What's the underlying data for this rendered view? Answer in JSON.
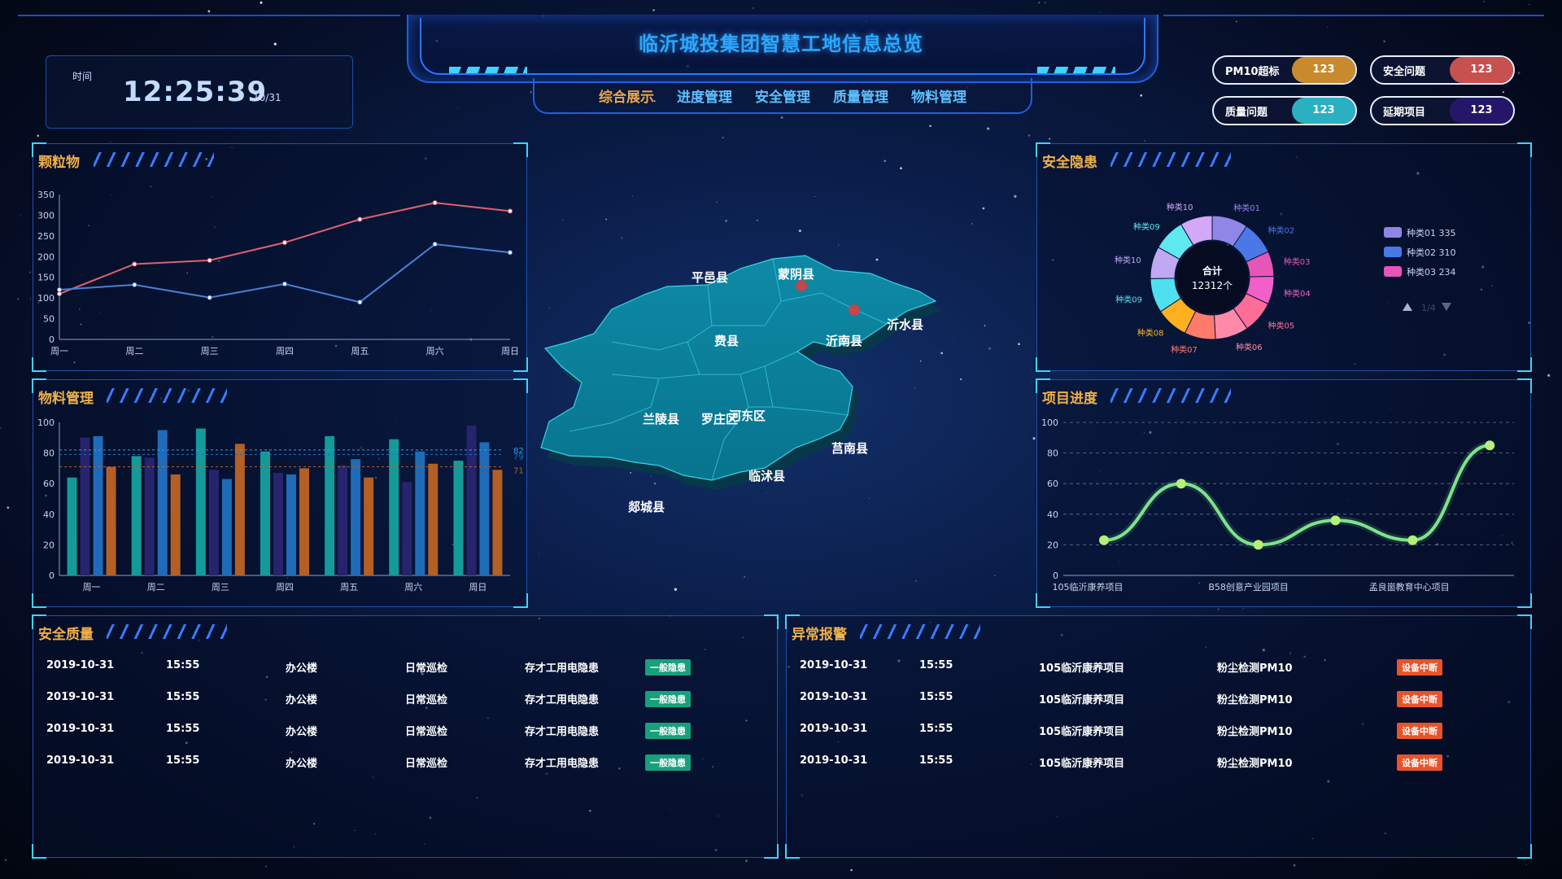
{
  "header": {
    "title": "临沂城投集团智慧工地信息总览",
    "nav": [
      {
        "label": "综合展示",
        "active": true
      },
      {
        "label": "进度管理",
        "active": false
      },
      {
        "label": "安全管理",
        "active": false
      },
      {
        "label": "质量管理",
        "active": false
      },
      {
        "label": "物料管理",
        "active": false
      }
    ]
  },
  "clock": {
    "label": "时间",
    "time": "12:25:39",
    "date": "10/31"
  },
  "badges": [
    {
      "label": "PM10超标",
      "value": "123",
      "color": "#c98a2e"
    },
    {
      "label": "安全问题",
      "value": "123",
      "color": "#c7514e"
    },
    {
      "label": "质量问题",
      "value": "123",
      "color": "#2bb0c2"
    },
    {
      "label": "延期项目",
      "value": "123",
      "color": "#24176a"
    }
  ],
  "panels": {
    "particles": "颗粒物",
    "materials": "物料管理",
    "safety": "安全隐患",
    "progress": "项目进度",
    "safety_quality": "安全质量",
    "alarms": "异常报警"
  },
  "chart_data": [
    {
      "id": "particles",
      "type": "line",
      "categories": [
        "周一",
        "周二",
        "周三",
        "周四",
        "周五",
        "周六",
        "周日"
      ],
      "ylim": [
        0,
        350
      ],
      "yticks": [
        "0",
        "50",
        "100",
        "150",
        "200",
        "250",
        "300",
        "350"
      ],
      "series": [
        {
          "values": [
            110,
            182,
            191,
            234,
            290,
            330,
            310
          ],
          "color": "#e0606e"
        },
        {
          "values": [
            120,
            132,
            101,
            134,
            90,
            230,
            210
          ],
          "color": "#4a7fd6"
        }
      ]
    },
    {
      "id": "materials",
      "type": "bar",
      "categories": [
        "周一",
        "周二",
        "周三",
        "周四",
        "周五",
        "周六",
        "周日"
      ],
      "ylim": [
        0,
        100
      ],
      "yticks": [
        "0",
        "20",
        "40",
        "60",
        "80",
        "100"
      ],
      "series": [
        {
          "values": [
            64,
            78,
            96,
            81,
            91,
            89,
            75
          ],
          "color": "#159a9a"
        },
        {
          "values": [
            90,
            77,
            69,
            67,
            72,
            61,
            98
          ],
          "color": "#27246e"
        },
        {
          "values": [
            91,
            95,
            63,
            66,
            76,
            81,
            87
          ],
          "color": "#1f6bb8"
        },
        {
          "values": [
            71,
            66,
            86,
            70,
            64,
            73,
            69
          ],
          "color": "#b35f25"
        }
      ],
      "markers": [
        {
          "label": "82",
          "value": 82,
          "color": "#2da6e0"
        },
        {
          "label": "79",
          "value": 79,
          "color": "#1d6fbf"
        },
        {
          "label": "71",
          "value": 71,
          "color": "#b35f25"
        }
      ]
    },
    {
      "id": "safety",
      "type": "pie",
      "center_label": "合计",
      "center_value": "12312个",
      "slices": [
        {
          "name": "种类01",
          "value": 335,
          "color": "#8f86e8"
        },
        {
          "name": "种类02",
          "value": 310,
          "color": "#4a78e6"
        },
        {
          "name": "种类03",
          "value": 234,
          "color": "#e655b8"
        },
        {
          "name": "种类04",
          "value": 260,
          "color": "#f25fc8"
        },
        {
          "name": "种类05",
          "value": 300,
          "color": "#ff6c98"
        },
        {
          "name": "种类06",
          "value": 310,
          "color": "#ff8aa8"
        },
        {
          "name": "种类07",
          "value": 290,
          "color": "#ff7a6a"
        },
        {
          "name": "种类08",
          "value": 300,
          "color": "#ffb020"
        },
        {
          "name": "种类09",
          "value": 320,
          "color": "#4fe0ef"
        },
        {
          "name": "种类10",
          "value": 300,
          "color": "#c1a8f2"
        },
        {
          "name": "种类09",
          "value": 300,
          "color": "#5fe8f0"
        },
        {
          "name": "种类10",
          "value": 300,
          "color": "#d4a8f6"
        }
      ],
      "legend": [
        {
          "name": "种类01",
          "value": "335",
          "color": "#8f86e8"
        },
        {
          "name": "种类02",
          "value": "310",
          "color": "#4a78e6"
        },
        {
          "name": "种类03",
          "value": "234",
          "color": "#e655b8"
        }
      ],
      "pager": "1/4"
    },
    {
      "id": "progress",
      "type": "line",
      "categories": [
        "105临沂康养项目",
        "",
        "B58创意产业园项目",
        "",
        "孟良崮教育中心项目",
        ""
      ],
      "ylim": [
        0,
        100
      ],
      "yticks": [
        "0",
        "20",
        "40",
        "60",
        "80",
        "100"
      ],
      "series": [
        {
          "values": [
            23,
            60,
            20,
            36,
            23,
            85
          ],
          "color": "#7fe38a"
        }
      ]
    }
  ],
  "map": {
    "counties": [
      "平邑县",
      "蒙阴县",
      "沂水县",
      "费县",
      "沂南县",
      "兰陵县",
      "罗庄区",
      "河东区",
      "莒南县",
      "临沭县",
      "郯城县"
    ]
  },
  "safety_quality": {
    "rows": [
      {
        "date": "2019-10-31",
        "time": "15:55",
        "place": "办公楼",
        "type": "日常巡检",
        "issue": "存才工用电隐患",
        "tag": "一般隐患"
      },
      {
        "date": "2019-10-31",
        "time": "15:55",
        "place": "办公楼",
        "type": "日常巡检",
        "issue": "存才工用电隐患",
        "tag": "一般隐患"
      },
      {
        "date": "2019-10-31",
        "time": "15:55",
        "place": "办公楼",
        "type": "日常巡检",
        "issue": "存才工用电隐患",
        "tag": "一般隐患"
      },
      {
        "date": "2019-10-31",
        "time": "15:55",
        "place": "办公楼",
        "type": "日常巡检",
        "issue": "存才工用电隐患",
        "tag": "一般隐患"
      }
    ]
  },
  "alarms": {
    "rows": [
      {
        "date": "2019-10-31",
        "time": "15:55",
        "project": "105临沂康养项目",
        "sensor": "粉尘检测PM10",
        "tag": "设备中断"
      },
      {
        "date": "2019-10-31",
        "time": "15:55",
        "project": "105临沂康养项目",
        "sensor": "粉尘检测PM10",
        "tag": "设备中断"
      },
      {
        "date": "2019-10-31",
        "time": "15:55",
        "project": "105临沂康养项目",
        "sensor": "粉尘检测PM10",
        "tag": "设备中断"
      },
      {
        "date": "2019-10-31",
        "time": "15:55",
        "project": "105临沂康养项目",
        "sensor": "粉尘检测PM10",
        "tag": "设备中断"
      }
    ]
  }
}
